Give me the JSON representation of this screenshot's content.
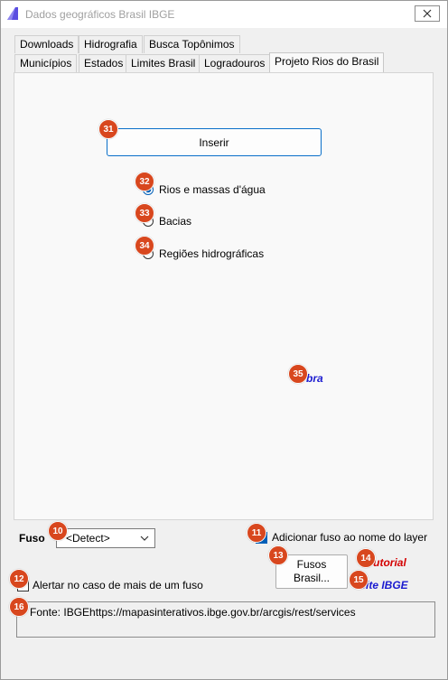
{
  "window": {
    "title": "Dados geográficos Brasil IBGE",
    "close_icon": "close-icon"
  },
  "tabs_row1": [
    "Downloads",
    "Hidrografia",
    "Busca Topônimos"
  ],
  "tabs_row2": [
    "Municípios",
    "Estados",
    "Limites Brasil",
    "Logradouros",
    "Projeto Rios do Brasil"
  ],
  "active_tab": "Projeto Rios do Brasil",
  "panel": {
    "inserir_label": "Inserir",
    "radios": [
      {
        "label": "Rios e massas d'água",
        "checked": true
      },
      {
        "label": "Bacias",
        "checked": false
      },
      {
        "label": "Regiões hidrográficas",
        "checked": false
      }
    ],
    "link_text": "bra"
  },
  "fuso": {
    "label": "Fuso",
    "select_value": "<Detect>",
    "add_fuso_label": "Adicionar fuso ao nome do layer",
    "add_fuso_checked": true,
    "alert_label": "Alertar no caso de mais de um fuso",
    "alert_checked": false,
    "fusos_button": "Fusos Brasil...",
    "tutorial_link": "Tutorial",
    "site_link": "Site IBGE"
  },
  "fonte": "Fonte: IBGEhttps://mapasinterativos.ibge.gov.br/arcgis/rest/services",
  "badges": [
    "31",
    "32",
    "33",
    "34",
    "35",
    "10",
    "11",
    "12",
    "13",
    "14",
    "15",
    "16"
  ],
  "colors": {
    "badge": "#d8471e",
    "accent": "#0a6fc9",
    "tutorial": "#d40000",
    "site": "#1b1bd0"
  }
}
